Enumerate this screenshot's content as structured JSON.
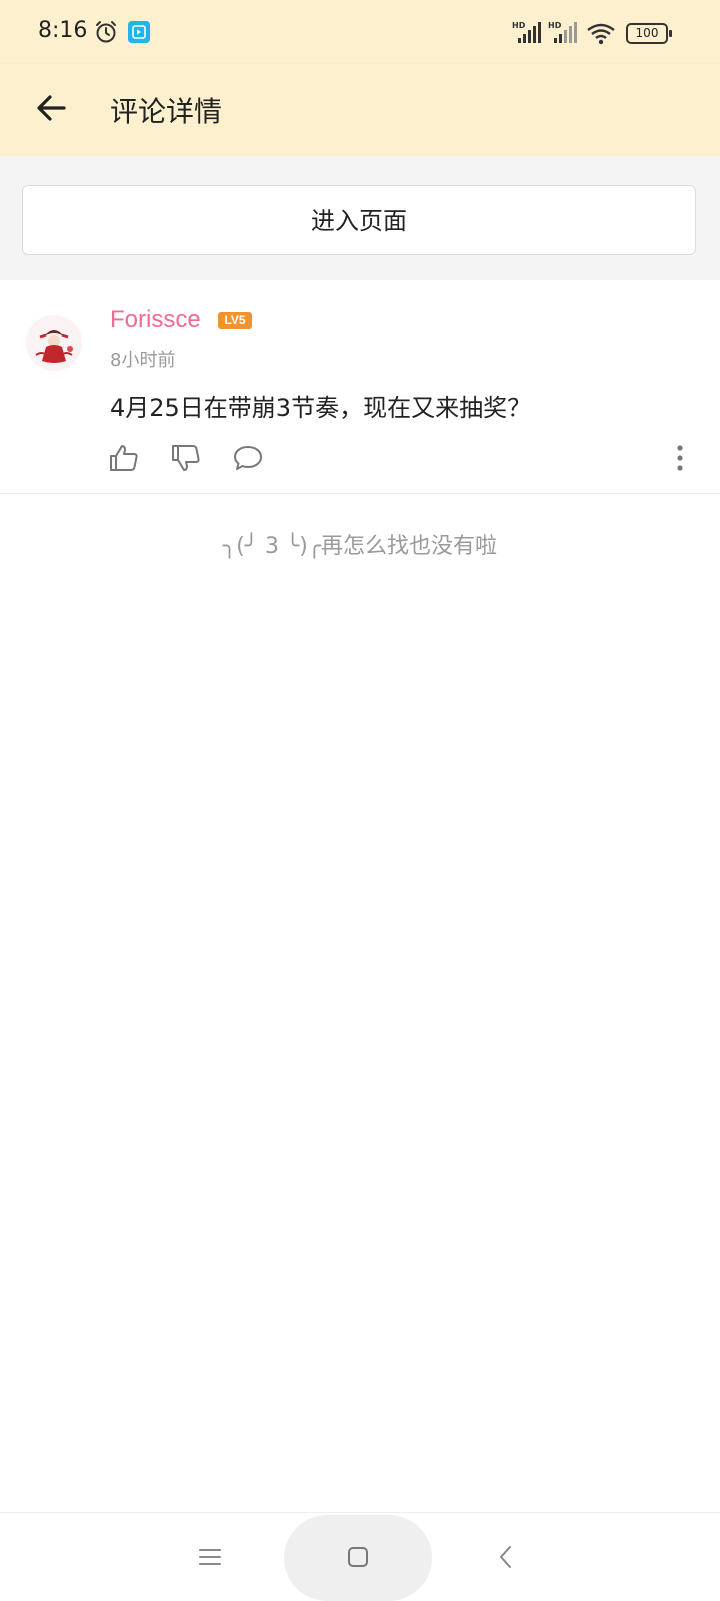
{
  "status_bar": {
    "time": "8:16",
    "icons": [
      "alarm-icon",
      "app-notification-icon",
      "signal-hd-icon",
      "signal-hd-icon",
      "wifi-icon",
      "battery-icon"
    ],
    "signal_label": "HD",
    "battery_level": "100"
  },
  "header": {
    "title": "评论详情",
    "back_icon": "arrow-left-icon"
  },
  "enter_page": {
    "label": "进入页面"
  },
  "comment": {
    "username": "Forissce",
    "level": "LV5",
    "time": "8小时前",
    "text": "4月25日在带崩3节奏，现在又来抽奖？",
    "actions": [
      "thumb-up-icon",
      "thumb-down-icon",
      "reply-bubble-icon",
      "more-vertical-icon"
    ]
  },
  "empty_state": {
    "message": "╮(╯ 3 ╰)╭再怎么找也没有啦"
  },
  "colors": {
    "header_bg": "#fdf0cf",
    "username": "#f06b91",
    "level_badge": "#f0932d",
    "secondary_text": "#9a9a9a"
  },
  "nav_bar": {
    "icons": [
      "menu-icon",
      "home-square-icon",
      "back-chevron-icon"
    ]
  }
}
